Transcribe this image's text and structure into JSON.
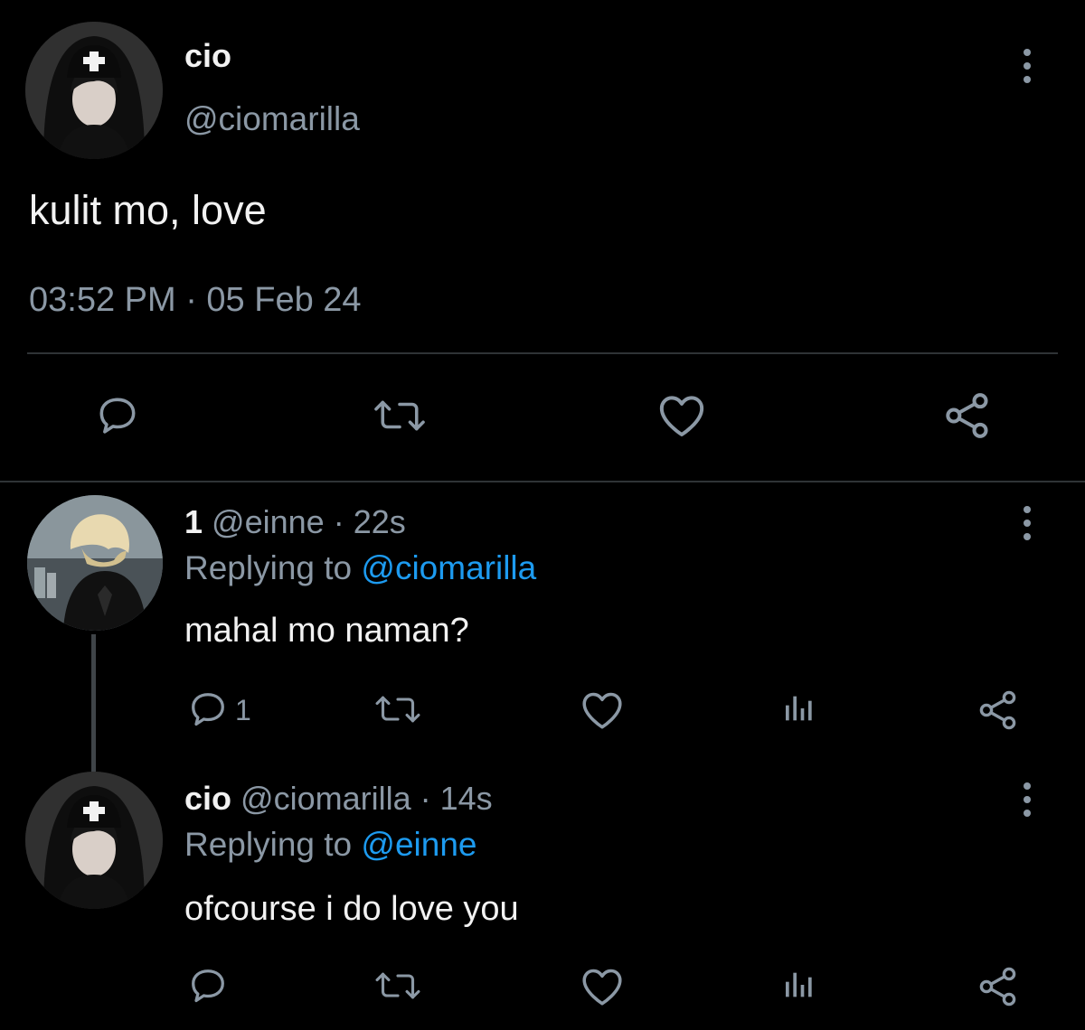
{
  "main_tweet": {
    "display_name": "cio",
    "handle": "@ciomarilla",
    "text": "kulit mo, love",
    "timestamp": "03:52 PM · 05 Feb 24",
    "actions": [
      "reply-icon",
      "retweet-icon",
      "like-icon",
      "share-icon"
    ]
  },
  "replies": [
    {
      "display_name": "1",
      "handle": "@einne",
      "time": "· 22s",
      "replying_prefix": "Replying to",
      "replying_to": "@ciomarilla",
      "text": "mahal mo naman?",
      "reply_count": "1"
    },
    {
      "display_name": "cio",
      "handle": "@ciomarilla",
      "time": "· 14s",
      "replying_prefix": "Replying to",
      "replying_to": "@einne",
      "text": "ofcourse i do love you",
      "reply_count": ""
    }
  ],
  "colors": {
    "background": "#000000",
    "text": "#e7e9ea",
    "muted": "#8b98a5",
    "link": "#1d9bf0",
    "divider": "#2f3336"
  }
}
